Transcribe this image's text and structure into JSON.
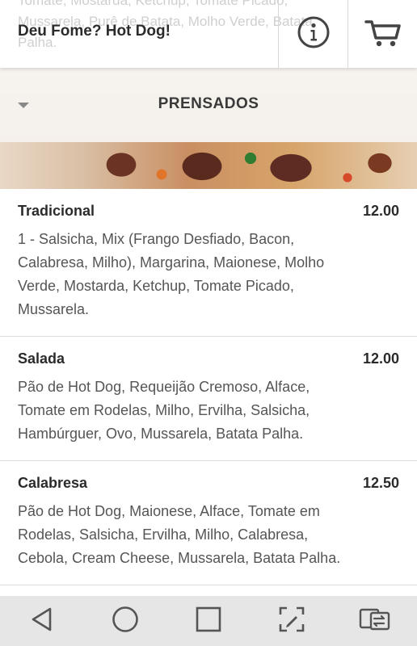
{
  "header": {
    "ghost_text": "Tomate, Mostarda, Ketchup, Tomate Picado, Mussarela, Purê de Batata, Molho Verde, Batata Palha.",
    "title": "Deu Fome? Hot Dog!",
    "info_icon": "info-icon",
    "cart_icon": "cart-icon"
  },
  "category": {
    "title": "PRENSADOS",
    "arrow_icon": "caret-down-icon"
  },
  "items": [
    {
      "name": "Tradicional",
      "price": "12.00",
      "description": "1 - Salsicha, Mix (Frango Desfiado, Bacon, Calabresa, Milho), Margarina, Maionese, Molho Verde, Mostarda, Ketchup, Tomate Picado, Mussarela."
    },
    {
      "name": "Salada",
      "price": "12.00",
      "description": "Pão de Hot Dog, Requeijão Cremoso, Alface, Tomate em Rodelas, Milho, Ervilha, Salsicha, Hambúrguer, Ovo, Mussarela, Batata Palha."
    },
    {
      "name": "Calabresa",
      "price": "12.50",
      "description": "Pão de Hot Dog, Maionese, Alface, Tomate em Rodelas, Salsicha, Ervilha, Milho, Calabresa, Cebola, Cream Cheese, Mussarela, Batata Palha."
    }
  ],
  "navbar": {
    "icons": [
      "back-icon",
      "home-icon",
      "recents-icon",
      "screenshot-edit-icon",
      "screen-switch-icon"
    ]
  },
  "colors": {
    "header_bg": "#ffffff",
    "text_dark": "#2b2b2b",
    "text_desc": "#555555",
    "divider": "#dcdcdc",
    "navbar_bg": "#e6e6e6"
  }
}
